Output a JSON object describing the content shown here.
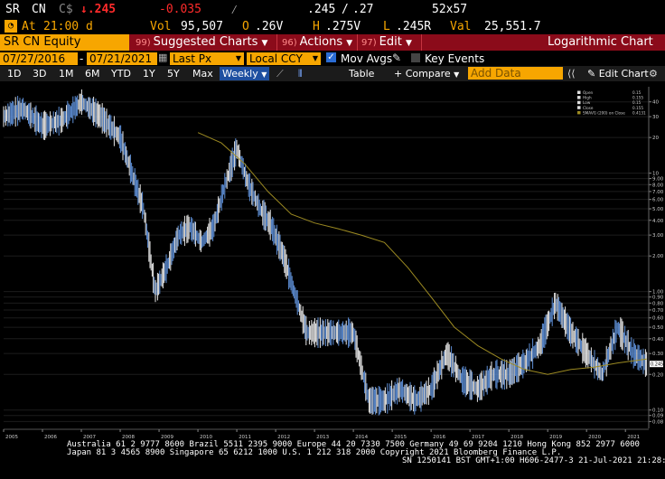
{
  "quote": {
    "ticker": "SR",
    "exchange": "CN",
    "currency": "C$",
    "last": "↓.245",
    "change": "-0.035",
    "range": ".245",
    "range_sep": "/",
    "range_hi": ".27",
    "size": "52x57",
    "at_label": "At",
    "time": "21:00 d",
    "vol_label": "Vol",
    "volume": "95,507",
    "open_label": "O",
    "open": ".26V",
    "high_label": "H",
    "high": ".275V",
    "low_label": "L",
    "low": ".245R",
    "val_label": "Val",
    "value": "25,551.7"
  },
  "menu": {
    "security": "SR CN Equity",
    "suggested": {
      "num": "99)",
      "label": "Suggested Charts"
    },
    "actions": {
      "num": "96)",
      "label": "Actions"
    },
    "edit": {
      "num": "97)",
      "label": "Edit"
    },
    "title": "Logarithmic Chart"
  },
  "controls": {
    "start_date": "07/27/2016",
    "end_date": "07/21/2021",
    "field": "Last Px",
    "currency": "Local CCY",
    "mov_avgs": "Mov Avgs",
    "key_events": "Key Events",
    "periods": [
      "1D",
      "3D",
      "1M",
      "6M",
      "YTD",
      "1Y",
      "5Y",
      "Max"
    ],
    "frequency": "Weekly",
    "table": "Table",
    "compare": "Compare",
    "add_data_placeholder": "Add Data",
    "edit_chart": "Edit Chart"
  },
  "chart_data": {
    "type": "line",
    "scale": "log",
    "x_ticks": [
      "2005",
      "2006",
      "2007",
      "2008",
      "2009",
      "2010",
      "2011",
      "2012",
      "2013",
      "2014",
      "2015",
      "2016",
      "2017",
      "2018",
      "2019",
      "2020",
      "2021"
    ],
    "y_ticks": [
      "40",
      "30",
      "20",
      "10",
      "9.00",
      "8.00",
      "7.00",
      "6.00",
      "5.00",
      "4.00",
      "3.00",
      "2.00",
      "1.00",
      "0.90",
      "0.80",
      "0.70",
      "0.60",
      "0.50",
      "0.40",
      "0.30",
      "0.20",
      "0.10",
      "0.09",
      "0.08"
    ],
    "legend": [
      {
        "name": "Open",
        "value": "0.15"
      },
      {
        "name": "High",
        "value": "0.155"
      },
      {
        "name": "Low",
        "value": "0.15"
      },
      {
        "name": "Close",
        "value": "0.155"
      },
      {
        "name": "SMAVG (200) on Close",
        "value": "0.4131"
      }
    ],
    "last_price_tag": "0.245",
    "sma_color": "#9c8a22",
    "series": [
      {
        "name": "Price",
        "x": [
          2005.0,
          2005.5,
          2006.0,
          2006.5,
          2007.0,
          2007.5,
          2008.0,
          2008.3,
          2008.6,
          2008.9,
          2009.2,
          2009.5,
          2009.8,
          2010.1,
          2010.4,
          2010.7,
          2011.0,
          2011.3,
          2011.6,
          2011.9,
          2012.2,
          2012.4,
          2012.8,
          2013.2,
          2013.6,
          2014.0,
          2014.4,
          2014.8,
          2015.2,
          2015.6,
          2016.0,
          2016.4,
          2016.8,
          2017.2,
          2017.6,
          2018.0,
          2018.4,
          2018.8,
          2019.2,
          2019.6,
          2020.0,
          2020.4,
          2020.8,
          2021.2,
          2021.55
        ],
        "values": [
          30,
          35,
          25,
          28,
          40,
          30,
          20,
          10,
          5,
          1.0,
          1.6,
          3.0,
          3.5,
          2.6,
          3.5,
          8,
          16,
          8,
          5,
          3.5,
          2.0,
          1.2,
          0.45,
          0.45,
          0.45,
          0.45,
          0.12,
          0.12,
          0.15,
          0.12,
          0.15,
          0.3,
          0.18,
          0.15,
          0.2,
          0.2,
          0.25,
          0.35,
          0.8,
          0.45,
          0.3,
          0.2,
          0.5,
          0.3,
          0.245
        ]
      },
      {
        "name": "SMAVG (200) on Close",
        "x": [
          2010.0,
          2010.6,
          2011.2,
          2011.8,
          2012.4,
          2013.0,
          2013.6,
          2014.2,
          2014.8,
          2015.4,
          2016.0,
          2016.6,
          2017.2,
          2017.8,
          2018.4,
          2019.0,
          2019.6,
          2020.2,
          2020.8,
          2021.55
        ],
        "values": [
          22,
          18,
          12,
          7,
          4.5,
          3.8,
          3.4,
          3.0,
          2.6,
          1.6,
          0.9,
          0.5,
          0.35,
          0.27,
          0.22,
          0.2,
          0.22,
          0.23,
          0.25,
          0.27
        ]
      }
    ]
  },
  "footer": {
    "line1": "Australia 61 2 9777 8600 Brazil 5511 2395 9000 Europe 44 20 7330 7500 Germany 49 69 9204 1210 Hong Kong 852 2977 6000",
    "line2": "Japan 81 3 4565 8900        Singapore 65 6212 1000       U.S. 1 212 318 2000         Copyright 2021 Bloomberg Finance L.P.",
    "line3": "SN 1250141 BST  GMT+1:00 H606-2477-3 21-Jul-2021 21:28:56"
  }
}
